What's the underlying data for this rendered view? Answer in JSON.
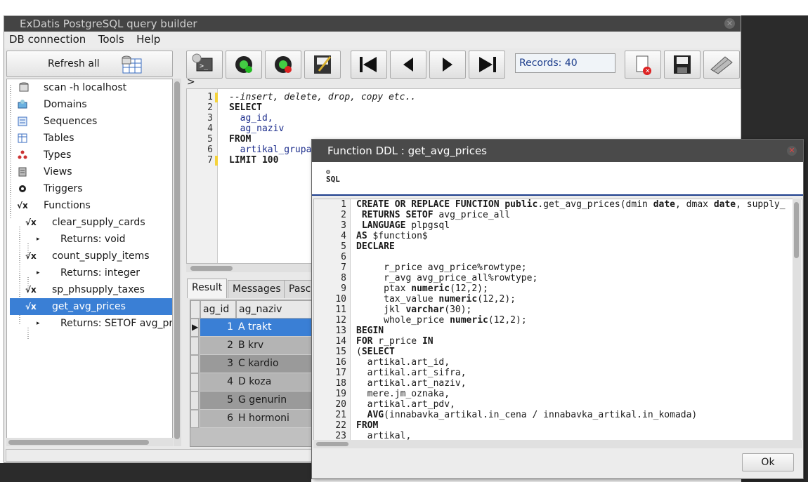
{
  "window": {
    "title": "ExDatis PostgreSQL query builder"
  },
  "menu": [
    "DB connection",
    "Tools",
    "Help"
  ],
  "left": {
    "refresh_label": "Refresh all",
    "tree": [
      {
        "label": "scan -h localhost",
        "icon": "database-icon"
      },
      {
        "label": "Domains",
        "icon": "domains-icon"
      },
      {
        "label": "Sequences",
        "icon": "sequences-icon"
      },
      {
        "label": "Tables",
        "icon": "table-icon"
      },
      {
        "label": "Types",
        "icon": "types-icon"
      },
      {
        "label": "Views",
        "icon": "views-icon"
      },
      {
        "label": "Triggers",
        "icon": "triggers-icon"
      },
      {
        "label": "Functions",
        "icon": "function-icon"
      },
      {
        "label": "clear_supply_cards",
        "icon": "function-icon"
      },
      {
        "label": "Returns: void",
        "icon": ""
      },
      {
        "label": "count_supply_items",
        "icon": "function-icon"
      },
      {
        "label": "Returns: integer",
        "icon": ""
      },
      {
        "label": "sp_phsupply_taxes",
        "icon": "function-icon"
      },
      {
        "label": "get_avg_prices",
        "icon": "function-icon",
        "selected": true
      },
      {
        "label": "Returns: SETOF avg_price",
        "icon": ""
      }
    ]
  },
  "toolbar": {
    "records": "Records: 40",
    "arrow": ">",
    "buttons": [
      "run-script-icon",
      "connect-icon",
      "disconnect-icon",
      "edit-save-icon",
      "first-record-icon",
      "prev-record-icon",
      "next-record-icon",
      "last-record-icon",
      "delete-file-icon",
      "save-icon",
      "clear-icon"
    ]
  },
  "editor": {
    "lines": [
      "--insert, delete, drop, copy etc..",
      "SELECT",
      "  ag_id,",
      "  ag_naziv",
      "FROM",
      "  artikal_grupa",
      "LIMIT 100"
    ],
    "line_numbers": [
      "1",
      "2",
      "3",
      "4",
      "5",
      "6",
      "7"
    ]
  },
  "result": {
    "tabs": [
      "Result",
      "Messages",
      "Pasc"
    ],
    "columns": [
      "ag_id",
      "ag_naziv"
    ],
    "rows": [
      {
        "id": "1",
        "naziv": "A trakt"
      },
      {
        "id": "2",
        "naziv": "B krv"
      },
      {
        "id": "3",
        "naziv": "C kardio"
      },
      {
        "id": "4",
        "naziv": "D koza"
      },
      {
        "id": "5",
        "naziv": "G genurin"
      },
      {
        "id": "6",
        "naziv": "H hormoni"
      }
    ]
  },
  "dialog": {
    "title": "Function DDL : get_avg_prices",
    "sql_icon_label": "SQL",
    "ok_label": "Ok",
    "line_numbers": [
      "1",
      "2",
      "3",
      "4",
      "5",
      "6",
      "7",
      "8",
      "9",
      "10",
      "11",
      "12",
      "13",
      "14",
      "15",
      "16",
      "17",
      "18",
      "19",
      "20",
      "21",
      "22",
      "23"
    ],
    "lines": [
      "CREATE OR REPLACE FUNCTION public.get_avg_prices(dmin date, dmax date, supply_",
      " RETURNS SETOF avg_price_all",
      " LANGUAGE plpgsql",
      "AS $function$",
      "DECLARE",
      "",
      "     r_price avg_price%rowtype;",
      "     r_avg avg_price_all%rowtype;",
      "     ptax numeric(12,2);",
      "     tax_value numeric(12,2);",
      "     jkl varchar(30);",
      "     whole_price numeric(12,2);",
      "BEGIN",
      "FOR r_price IN",
      "(SELECT",
      "  artikal.art_id,",
      "  artikal.art_sifra,",
      "  artikal.art_naziv,",
      "  mere.jm_oznaka,",
      "  artikal.art_pdv,",
      "  AVG(innabavka_artikal.in_cena / innabavka_artikal.in_komada)",
      "FROM",
      "  artikal,"
    ]
  }
}
